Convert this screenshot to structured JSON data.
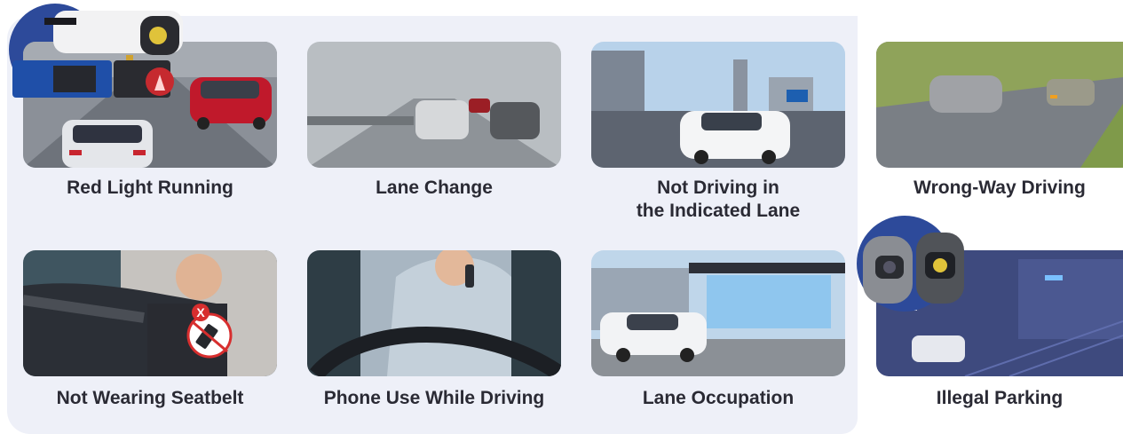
{
  "violations": [
    {
      "label": "Red Light Running"
    },
    {
      "label": "Lane Change"
    },
    {
      "label": "Not Driving in"
    },
    {
      "label": "Wrong-Way Driving"
    },
    {
      "label": "Not Wearing Seatbelt"
    },
    {
      "label": "Phone Use While Driving"
    },
    {
      "label": "Lane Occupation"
    },
    {
      "label": "Illegal Parking"
    }
  ],
  "label_line2": "the Indicated Lane",
  "colors": {
    "panel": "#eef0f8",
    "badge": "#2d4a9a",
    "text": "#2a2a34"
  }
}
